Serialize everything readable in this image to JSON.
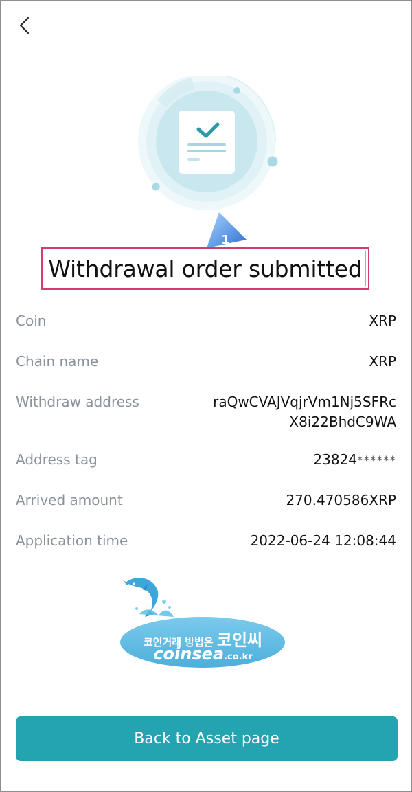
{
  "header": {
    "back_icon": "chevron-left-icon"
  },
  "status": {
    "title": "Withdrawal order submitted",
    "step_badge": "1",
    "illustration_icon": "document-check-icon"
  },
  "details": [
    {
      "label": "Coin",
      "value": "XRP"
    },
    {
      "label": "Chain name",
      "value": "XRP"
    },
    {
      "label": "Withdraw address",
      "value_line1": "raQwCVAJVqjrVm1Nj5SFRc",
      "value_line2": "X8i22BhdC9WA"
    },
    {
      "label": "Address tag",
      "value": "23824",
      "value_masked": "******"
    },
    {
      "label": "Arrived amount",
      "value": "270.470586XRP"
    },
    {
      "label": "Application time",
      "value": "2022-06-24 12:08:44"
    }
  ],
  "watermark": {
    "line1_small": "코인거래 방법은 ",
    "line1_big": "코인씨",
    "line2_main": "coinsea",
    "line2_small": ".co.kr"
  },
  "actions": {
    "back_to_asset": "Back to Asset page"
  },
  "colors": {
    "accent": "#24a3b1",
    "label": "#8a939c",
    "highlight_border": "#d63a72",
    "badge": "#3b8be0"
  }
}
